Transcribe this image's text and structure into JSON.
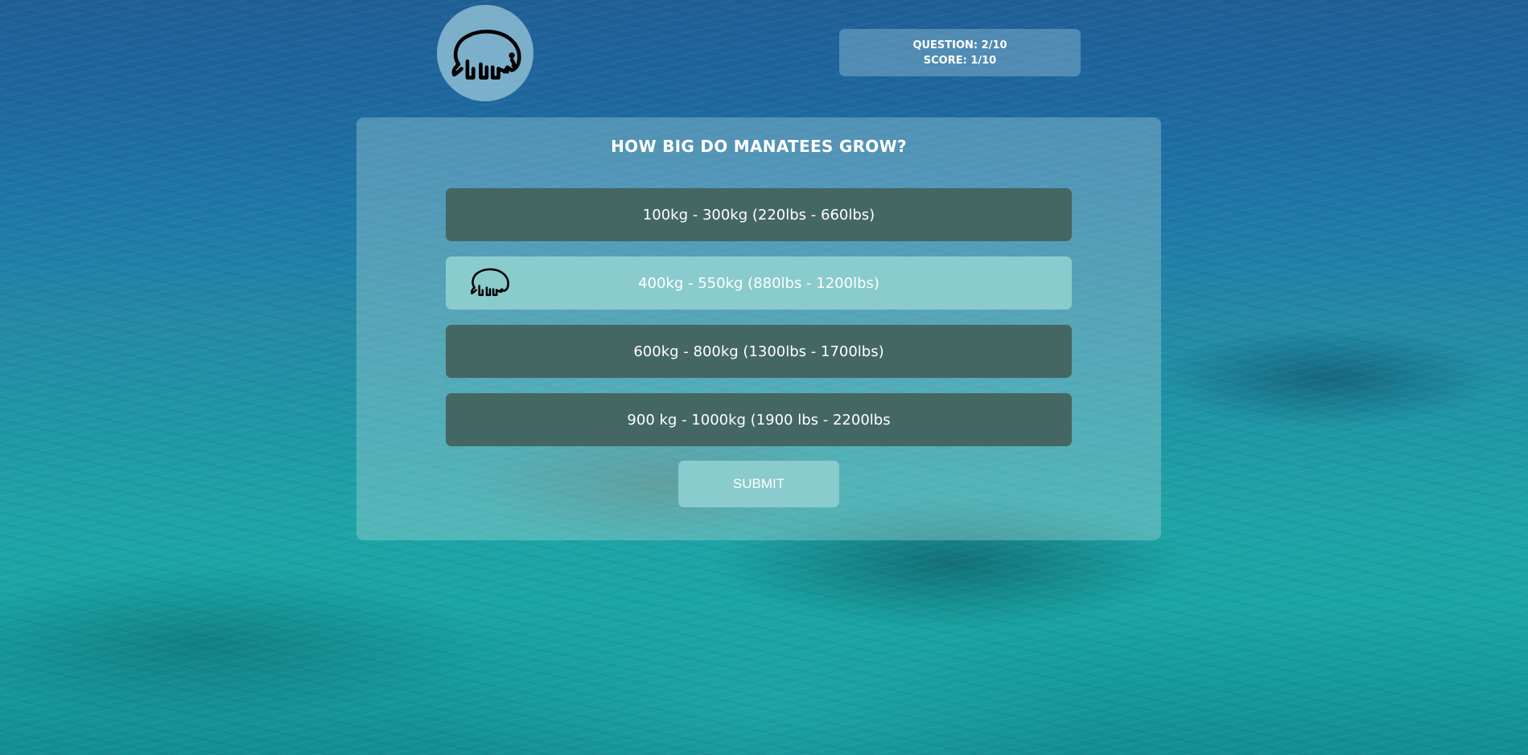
{
  "header": {
    "logo_icon": "manatee-icon",
    "status": {
      "question_label": "QUESTION: 2/10",
      "score_label": "SCORE: 1/10"
    }
  },
  "quiz": {
    "question": "HOW BIG DO MANATEES GROW?",
    "answers": [
      {
        "label": "100kg - 300kg (220lbs - 660lbs)",
        "selected": false
      },
      {
        "label": "400kg - 550kg (880lbs - 1200lbs)",
        "selected": true,
        "icon": "manatee-icon"
      },
      {
        "label": "600kg - 800kg (1300lbs - 1700lbs)",
        "selected": false
      },
      {
        "label": "900 kg - 1000kg (1900 lbs - 2200lbs",
        "selected": false
      }
    ],
    "submit_label": "SUBMIT"
  },
  "colors": {
    "answer_default": "#446764",
    "answer_selected": "#8acbcd",
    "submit": "#8acbcd"
  }
}
